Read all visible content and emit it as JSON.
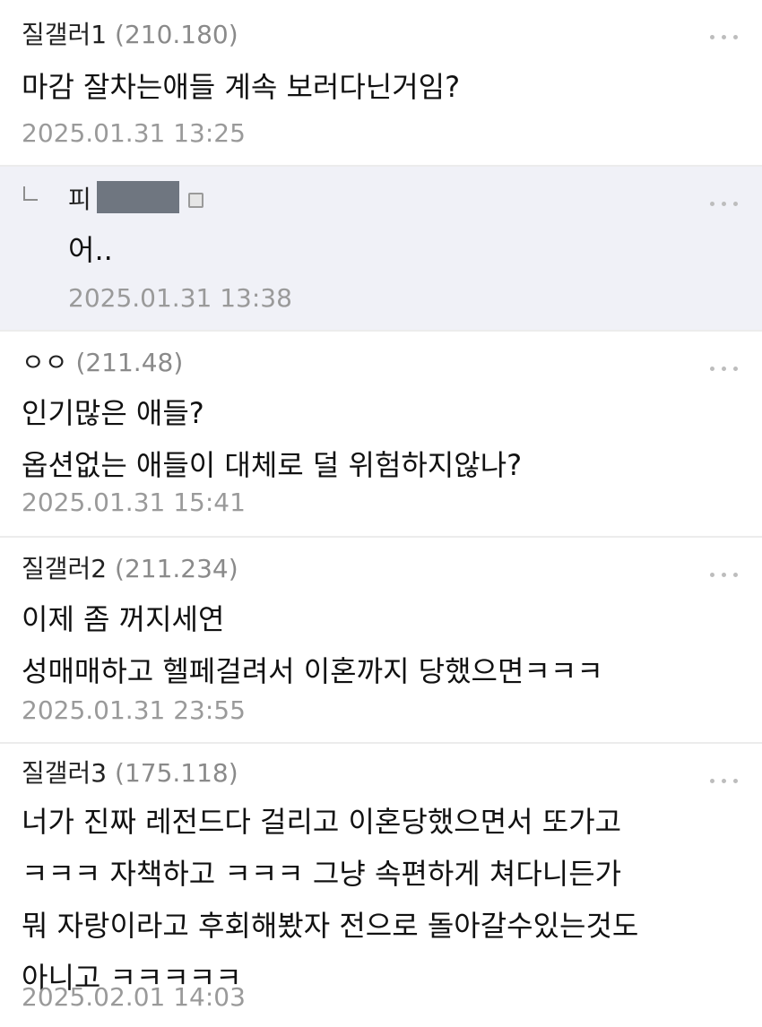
{
  "comments": [
    {
      "nickname": "질갤러1",
      "ip": "(210.180)",
      "lines": [
        "마감 잘차는애들 계속 보러다닌거임?"
      ],
      "date": "2025.01.31 13:25"
    },
    {
      "nickname": "피",
      "lines": [
        "어.."
      ],
      "date": "2025.01.31 13:38",
      "reply": true
    },
    {
      "nickname": "ㅇㅇ",
      "ip": "(211.48)",
      "lines": [
        "인기많은 애들?",
        "옵션없는 애들이 대체로 덜 위험하지않나?"
      ],
      "date": "2025.01.31 15:41"
    },
    {
      "nickname": "질갤러2",
      "ip": "(211.234)",
      "lines": [
        "이제 좀 꺼지세연",
        "성매매하고 헬페걸려서 이혼까지 당했으면ㅋㅋㅋ"
      ],
      "date": "2025.01.31 23:55"
    },
    {
      "nickname": "질갤러3",
      "ip": "(175.118)",
      "lines": [
        "너가 진짜 레전드다 걸리고 이혼당했으면서 또가고",
        "ㅋㅋㅋ 자책하고 ㅋㅋㅋ 그냥 속편하게 쳐다니든가",
        "뭐 자랑이라고 후회해봤자 전으로 돌아갈수있는것도",
        "아니고 ㅋㅋㅋㅋㅋ"
      ],
      "date": "2025.02.01 14:03"
    }
  ],
  "icons": {
    "more": "more-options-icon",
    "reply": "reply-arrow-icon",
    "badge": "user-badge-icon"
  }
}
